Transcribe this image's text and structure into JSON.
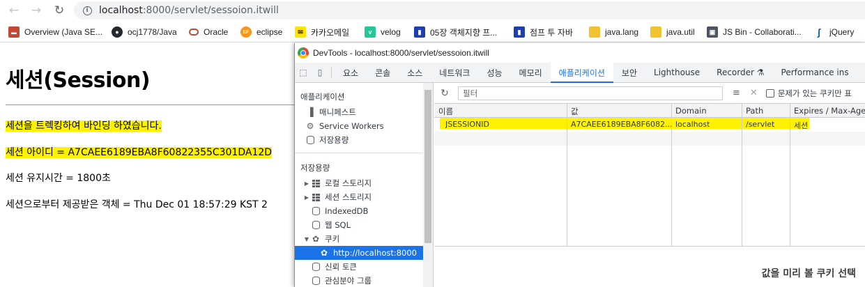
{
  "browser": {
    "url_host": "localhost",
    "url_path": ":8000/servlet/sessoion.itwill",
    "bookmarks": [
      {
        "label": "Overview (Java SE...",
        "icon": "oracle-icon",
        "color": "#c74634"
      },
      {
        "label": "ocj1778/Java",
        "icon": "github-icon",
        "color": "#24292e"
      },
      {
        "label": "Oracle",
        "icon": "oracle-ring-icon",
        "color": "#c74634"
      },
      {
        "label": "eclipse",
        "icon": "eclipse-icon",
        "color": "#f7941e"
      },
      {
        "label": "카카오메일",
        "icon": "kakao-mail-icon",
        "color": "#fee500"
      },
      {
        "label": "velog",
        "icon": "velog-icon",
        "color": "#20c997"
      },
      {
        "label": "05장 객체지향 프...",
        "icon": "book-icon",
        "color": "#1e40af"
      },
      {
        "label": "점프 투 자바",
        "icon": "book-icon",
        "color": "#1e40af"
      },
      {
        "label": "java.lang",
        "icon": "folder-icon",
        "color": "#f1c232"
      },
      {
        "label": "java.util",
        "icon": "folder-icon",
        "color": "#f1c232"
      },
      {
        "label": "JS Bin - Collaborati...",
        "icon": "jsbin-icon",
        "color": "#4b5563"
      },
      {
        "label": "jQuery",
        "icon": "jquery-icon",
        "color": "#0769ad"
      }
    ]
  },
  "page": {
    "title": "세션(Session)",
    "line1": "세션을 트렉킹하여 바인딩 하였습니다.",
    "line2": "세션 아이디 = A7CAEE6189EBA8F60822355C301DA12D",
    "line3": "세션 유지시간 = 1800초",
    "line4": "세션으로부터 제공받은 객체 = Thu Dec 01 18:57:29 KST 2"
  },
  "devtools": {
    "window_title": "DevTools - localhost:8000/servlet/sessoion.itwill",
    "tabs": [
      "요소",
      "콘솔",
      "소스",
      "네트워크",
      "성능",
      "메모리",
      "애플리케이션",
      "보안",
      "Lighthouse",
      "Recorder ⚗",
      "Performance ins"
    ],
    "active_tab": "애플리케이션",
    "sidebar": {
      "app_header": "애플리케이션",
      "app_items": [
        "매니페스트",
        "Service Workers",
        "저장용량"
      ],
      "storage_header": "저장용량",
      "storage_items": [
        "로컬 스토리지",
        "세션 스토리지",
        "IndexedDB",
        "웹 SQL",
        "쿠키",
        "http://localhost:8000",
        "신뢰 토큰",
        "관심분야 그룹"
      ]
    },
    "filter_placeholder": "필터",
    "filter_checkbox_label": "문제가 있는 쿠키만 표",
    "columns": [
      "이름",
      "값",
      "Domain",
      "Path",
      "Expires / Max-Age"
    ],
    "cookie": {
      "name": "JSESSIONID",
      "value": "A7CAEE6189EBA8F6082...",
      "domain": "localhost",
      "path": "/servlet",
      "expires": "세션"
    },
    "preview_message": "값을 미리 볼 쿠키 선택"
  }
}
